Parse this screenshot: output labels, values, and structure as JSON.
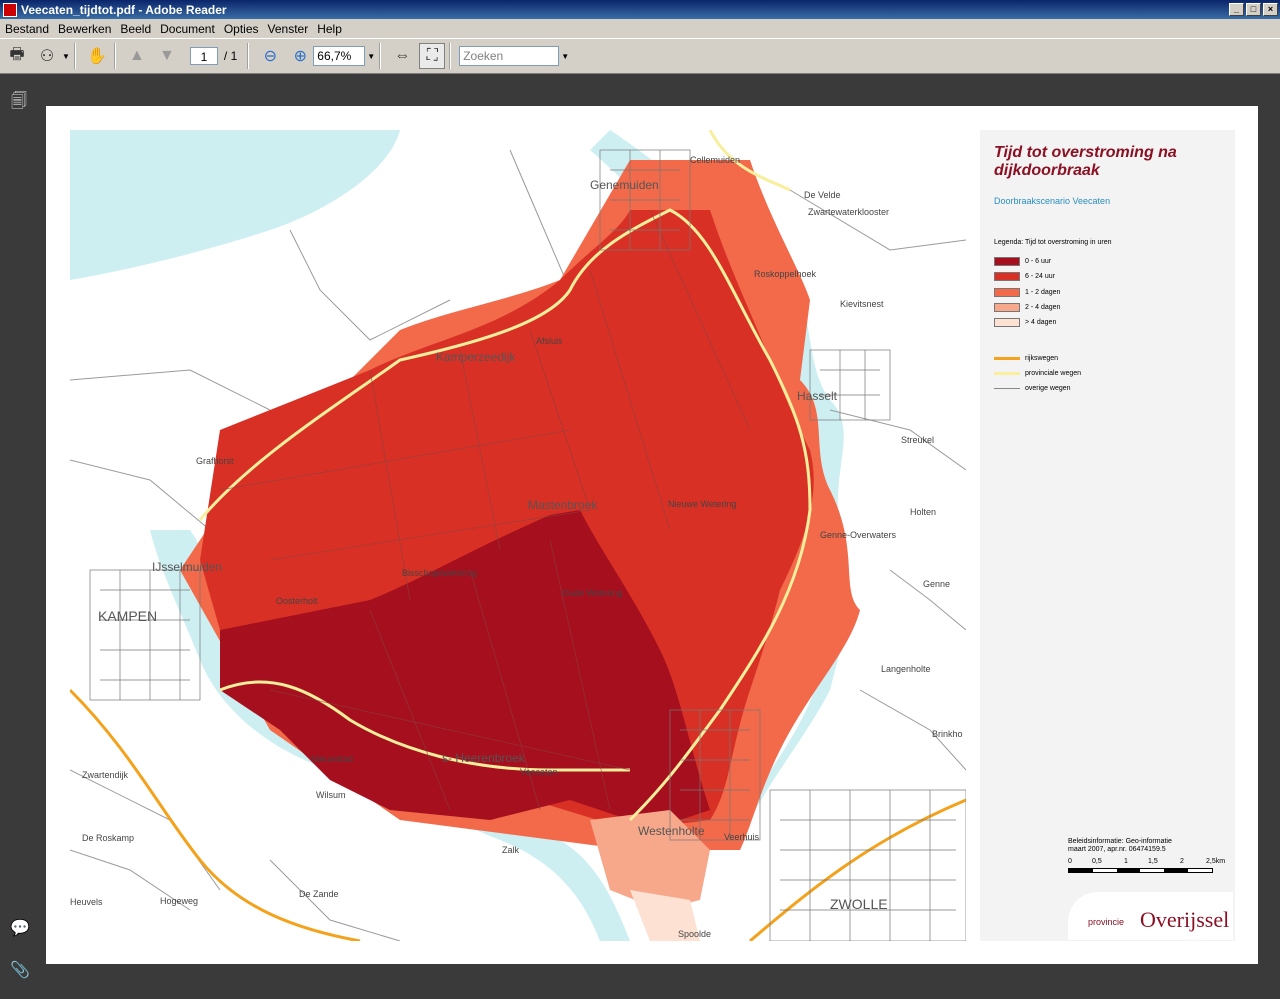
{
  "window": {
    "title": "Veecaten_tijdtot.pdf - Adobe Reader"
  },
  "menu": [
    "Bestand",
    "Bewerken",
    "Beeld",
    "Document",
    "Opties",
    "Venster",
    "Help"
  ],
  "toolbar": {
    "page_current": "1",
    "page_total": "/ 1",
    "zoom": "66,7%",
    "search_placeholder": "Zoeken"
  },
  "legend": {
    "title": "Tijd tot overstroming na dijkdoorbraak",
    "subtitle": "Doorbraakscenario Veecaten",
    "heading": "Legenda: Tijd tot overstroming in uren",
    "classes": [
      {
        "label": "0 - 6 uur",
        "color": "#a50f1e"
      },
      {
        "label": "6 - 24 uur",
        "color": "#d93025"
      },
      {
        "label": "1 - 2 dagen",
        "color": "#f26a4a"
      },
      {
        "label": "2 - 4 dagen",
        "color": "#f7a88a"
      },
      {
        "label": "> 4 dagen",
        "color": "#fde1d3"
      }
    ],
    "roads": [
      {
        "label": "rijkswegen",
        "color": "#f4a21c"
      },
      {
        "label": "provinciale wegen",
        "color": "#f8ee9c"
      },
      {
        "label": "overige wegen",
        "color": "#888888"
      }
    ],
    "credit_line1": "Beleidsinformatie: Geo-informatie",
    "credit_line2": "maart 2007, apr.nr. 06474159.5",
    "scale_labels": [
      "0",
      "0,5",
      "1",
      "1,5",
      "2",
      "2,5km"
    ],
    "logo_prefix": "provincie",
    "logo_name": "Overijssel"
  },
  "map_labels": {
    "genemuiden": "Genemuiden",
    "kampen": "KAMPEN",
    "ijsselmuiden": "IJsselmuiden",
    "hasselt": "Hasselt",
    "zwolle": "ZWOLLE",
    "mastenbroek": "Mastenbroek",
    "heerenbroek": "s- Heerenbroek",
    "kamperzeedijk": "Kamperzeedijk",
    "westenholte": "Westenholte",
    "de_velde": "De Velde",
    "zwartewaterklooster": "Zwartewaterklooster",
    "kievitsnest": "Kievitsnest",
    "roskamp": "De Roskamp",
    "de_zande": "De Zande",
    "hogeweg": "Hogeweg",
    "zwartendijk": "Zwartendijk",
    "nieuwstad": "Nieuwstad",
    "wilsum": "Wilsum",
    "veecaten": "Veecaten",
    "zalk": "Zalk",
    "spoolde": "Spoolde",
    "streukel": "Streukel",
    "holten": "Holten",
    "genne": "Genne",
    "genne_overwaters": "Genne-Overwaters",
    "langenholte": "Langenholte",
    "brinkho": "Brinkho",
    "roskoppel": "Roskoppelhoek",
    "grafhorst": "Grafhorst",
    "cellemuiden": "Cellemuiden",
    "oosterholt": "Oosterholt",
    "bisschopswetering": "Bisschopswetering",
    "oude_wetering": "Oude Wetering",
    "nieuwe_wetering": "Nieuwe Wetering",
    "heuvels": "Heuvels",
    "zwartsluis": "Zwartsluis",
    "veerhuis": "Veerhuis",
    "afsluis": "Afsluis"
  }
}
